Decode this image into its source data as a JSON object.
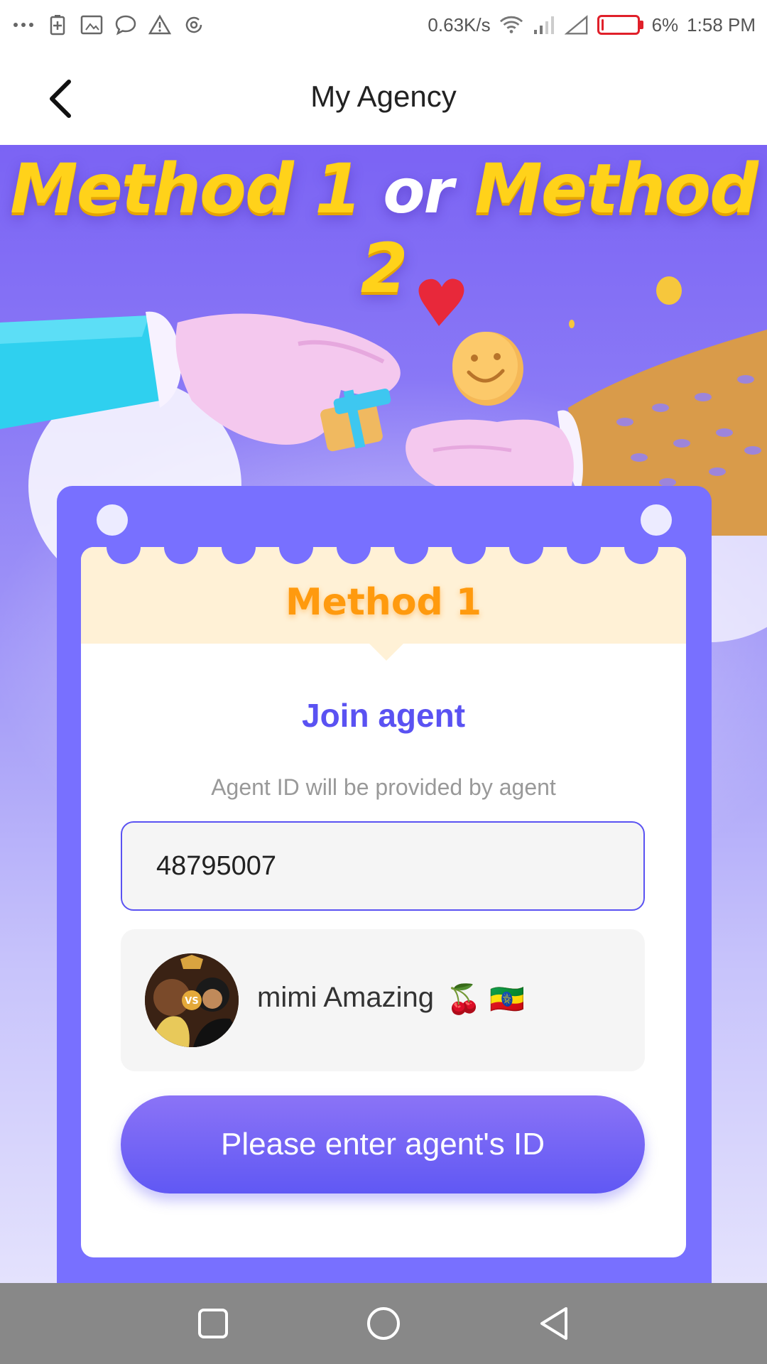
{
  "status_bar": {
    "net_speed": "0.63K/s",
    "battery": "6%",
    "battery_level": 0.06,
    "time": "1:58 PM",
    "icons": [
      "more-dots-icon",
      "battery-saver-icon",
      "screenshot-icon",
      "chat-icon",
      "warning-icon",
      "sync-icon",
      "wifi-icon",
      "signal-icon",
      "signal-empty-icon",
      "battery-icon"
    ]
  },
  "header": {
    "back_icon": "chevron-left-icon",
    "title": "My Agency"
  },
  "banner": {
    "method1": "Method 1",
    "or": "or",
    "method2": "Method 2"
  },
  "card": {
    "method_label": "Method 1",
    "join_title": "Join agent",
    "hint": "Agent ID will be provided by agent",
    "agent_id_value": "48795007",
    "agent": {
      "name": "mimi Amazing",
      "emoji": "🍒 🇪🇹",
      "avatar_caption": "VS"
    },
    "submit_label": "Please enter agent's ID"
  },
  "nav": {
    "recents_icon": "square-icon",
    "home_icon": "circle-icon",
    "back_icon": "triangle-back-icon"
  },
  "colors": {
    "accent": "#5a52f2",
    "card_border": "#7870ff",
    "method_orange": "#ff9a0e",
    "banner_yellow": "#ffd21a"
  }
}
